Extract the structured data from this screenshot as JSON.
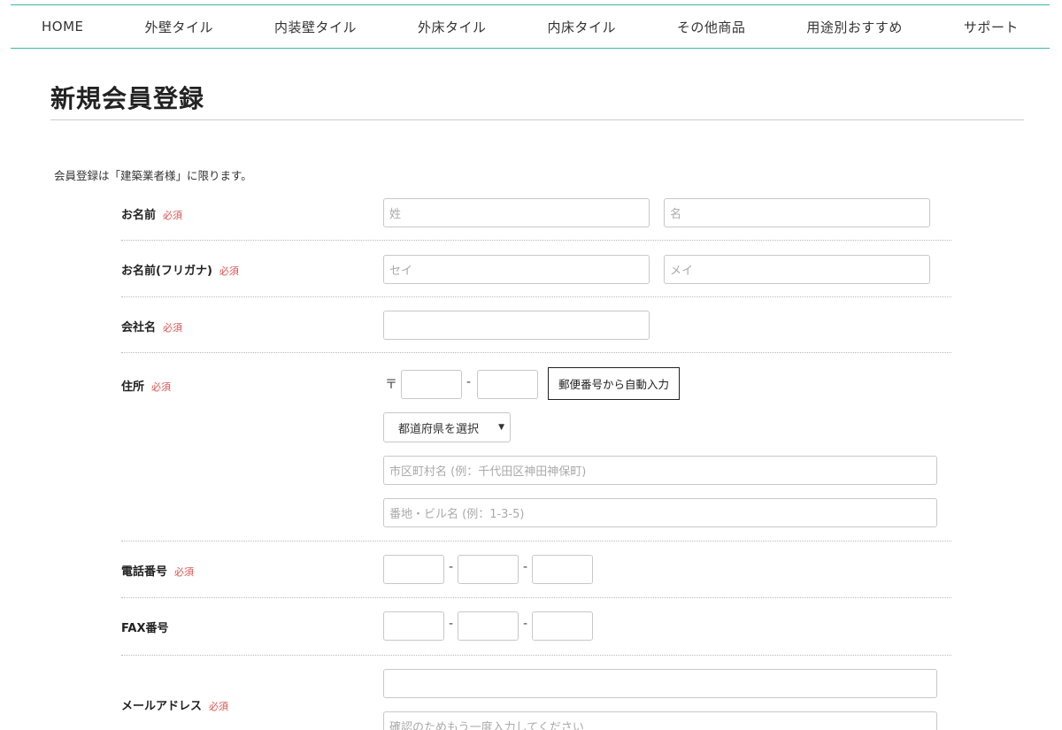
{
  "nav": [
    "HOME",
    "外壁タイル",
    "内装壁タイル",
    "外床タイル",
    "内床タイル",
    "その他商品",
    "用途別おすすめ",
    "サポート"
  ],
  "page_title": "新規会員登録",
  "notice": "会員登録は「建築業者様」に限ります。",
  "required_label": "必須",
  "fields": {
    "name": {
      "label": "お名前",
      "last_placeholder": "姓",
      "first_placeholder": "名"
    },
    "kana": {
      "label": "お名前(フリガナ)",
      "last_placeholder": "セイ",
      "first_placeholder": "メイ"
    },
    "company": {
      "label": "会社名",
      "placeholder": ""
    },
    "address": {
      "label": "住所",
      "postal_mark": "〒",
      "hyphen": "-",
      "zip_button": "郵便番号から自動入力",
      "prefecture_default": "都道府県を選択",
      "city_placeholder": "市区町村名 (例：千代田区神田神保町)",
      "street_placeholder": "番地・ビル名 (例：1-3-5)"
    },
    "phone": {
      "label": "電話番号",
      "hyphen": "-"
    },
    "fax": {
      "label": "FAX番号",
      "hyphen": "-"
    },
    "email": {
      "label": "メールアドレス",
      "placeholder": "",
      "confirm_placeholder": "確認のためもう一度入力してください"
    }
  }
}
